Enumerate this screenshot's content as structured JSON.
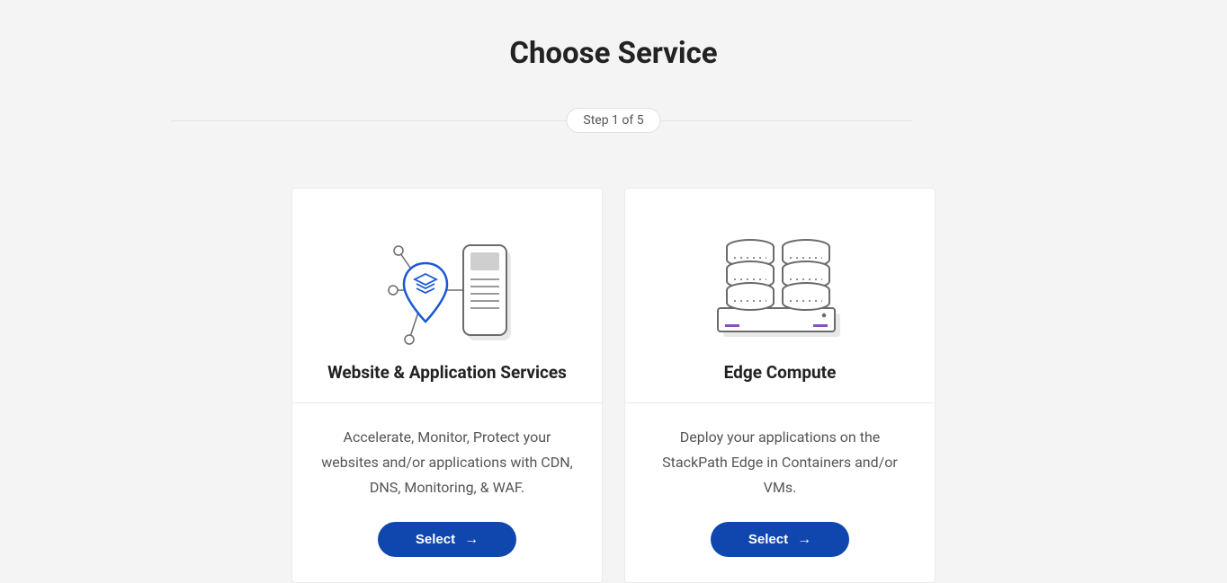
{
  "page": {
    "title": "Choose Service",
    "step_label": "Step 1 of 5"
  },
  "cards": [
    {
      "title": "Website & Application Services",
      "description": "Accelerate, Monitor, Protect your websites and/or applications with CDN, DNS, Monitoring, & WAF.",
      "button_label": "Select"
    },
    {
      "title": "Edge Compute",
      "description": "Deploy your applications on the StackPath Edge in Containers and/or VMs.",
      "button_label": "Select"
    }
  ]
}
